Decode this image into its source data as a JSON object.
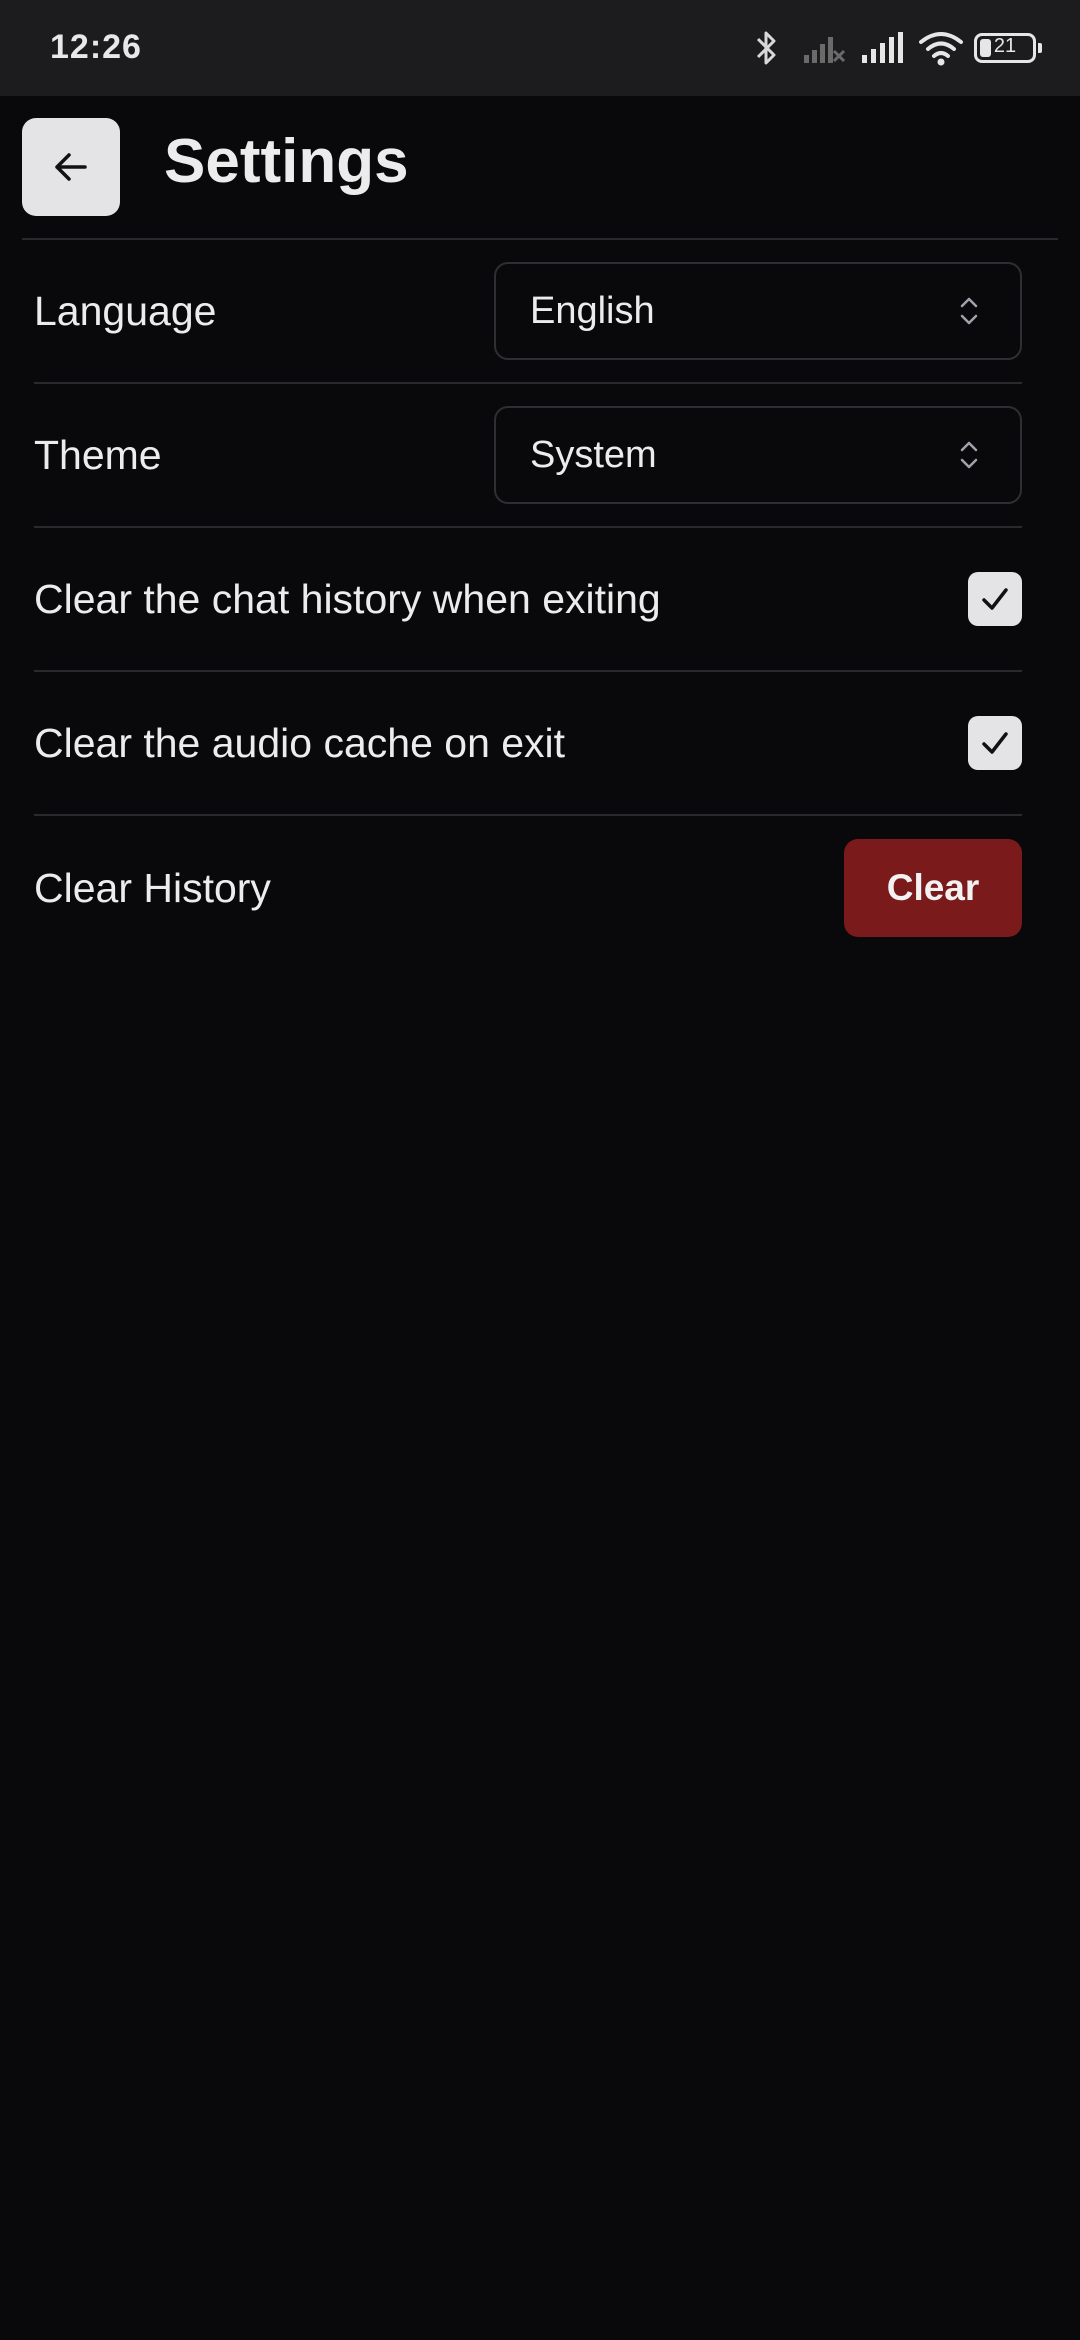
{
  "status_bar": {
    "time": "12:26",
    "battery_level": "21",
    "icons": [
      "bluetooth-icon",
      "signal-off-icon",
      "signal-icon",
      "wifi-icon",
      "battery-icon"
    ]
  },
  "header": {
    "title": "Settings",
    "back_icon": "arrow-left-icon"
  },
  "settings": {
    "language": {
      "label": "Language",
      "value": "English"
    },
    "theme": {
      "label": "Theme",
      "value": "System"
    },
    "clear_chat_on_exit": {
      "label": "Clear the chat history when exiting",
      "checked": true
    },
    "clear_audio_on_exit": {
      "label": "Clear the audio cache on exit",
      "checked": true
    },
    "clear_history": {
      "label": "Clear History",
      "button_label": "Clear"
    }
  },
  "colors": {
    "background": "#09090b",
    "danger": "#7a1a1a",
    "control_light": "#e4e4e7"
  }
}
